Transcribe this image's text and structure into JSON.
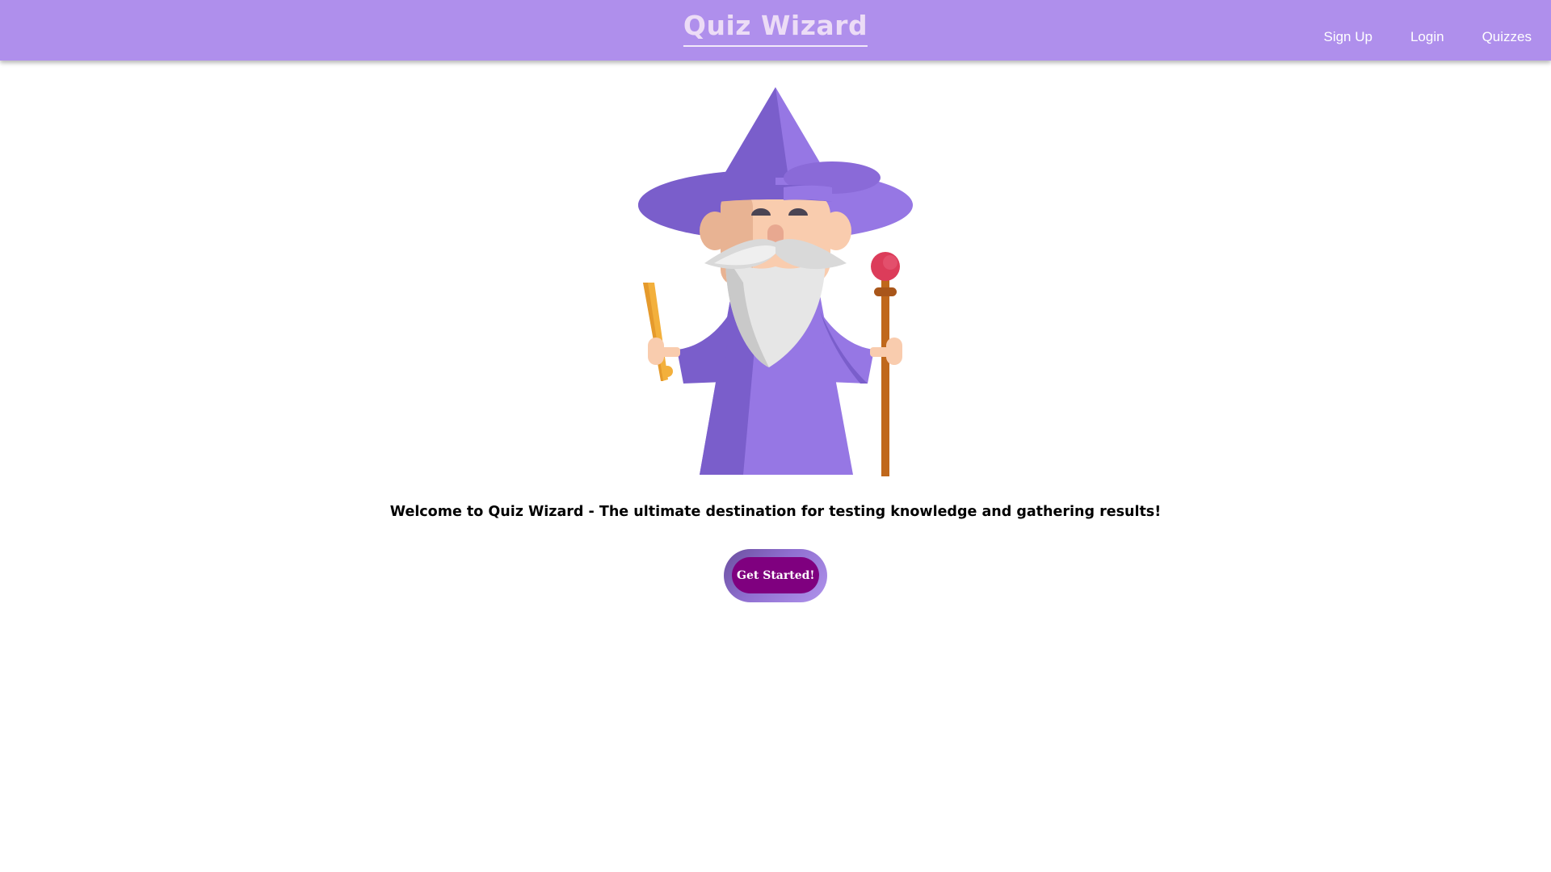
{
  "header": {
    "title": "Quiz Wizard",
    "nav": [
      {
        "label": "Sign Up"
      },
      {
        "label": "Login"
      },
      {
        "label": "Quizzes"
      }
    ]
  },
  "hero": {
    "illustration": "wizard-illustration",
    "welcome_text": "Welcome to Quiz Wizard - The ultimate destination for testing knowledge and gathering results!",
    "cta_label": "Get Started!"
  },
  "colors": {
    "navbar": "#af8fec",
    "brand_text": "#ecdcf6",
    "button": "#7f007f",
    "robe": "#9677e4",
    "robe_shadow": "#7a5ecb",
    "staff": "#c0681c",
    "orb": "#dc3c5a",
    "wand": "#f3b03c"
  }
}
